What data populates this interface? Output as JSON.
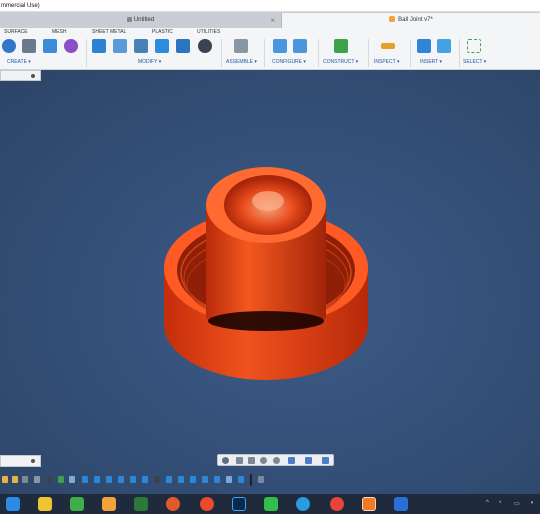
{
  "window": {
    "title": "mmercial Use)"
  },
  "tabs": [
    {
      "label": "Untitled",
      "close": "×"
    },
    {
      "label": "Ball Joint v7*"
    }
  ],
  "ribbon": {
    "tabs": [
      "SURFACE",
      "MESH",
      "SHEET METAL",
      "PLASTIC",
      "UTILITIES"
    ],
    "groups": [
      "CREATE ▾",
      "MODIFY ▾",
      "ASSEMBLE ▾",
      "CONFIGURE ▾",
      "CONSTRUCT ▾",
      "INSPECT ▾",
      "INSERT ▾",
      "SELECT ▾"
    ]
  },
  "colors": {
    "accent": "#1e5aa8",
    "viewport": "#35517a",
    "part": "#e23b12",
    "taskbar": "#1f2a3d"
  },
  "icons": {
    "browser_pin": "pin-icon",
    "comments_pin": "pin-icon",
    "nav": [
      "orbit-icon",
      "look-icon",
      "pan-icon",
      "zoom-icon",
      "zoom-window-icon",
      "display-icon",
      "grid-icon",
      "viewports-icon"
    ],
    "taskbar": [
      "start-icon",
      "explorer-icon",
      "store-icon",
      "calendar-icon",
      "edge-icon",
      "chrome-icon",
      "photoshop-icon",
      "teams-icon",
      "telegram-icon",
      "chrome-alt-icon",
      "fusion-icon",
      "mail-icon"
    ]
  }
}
